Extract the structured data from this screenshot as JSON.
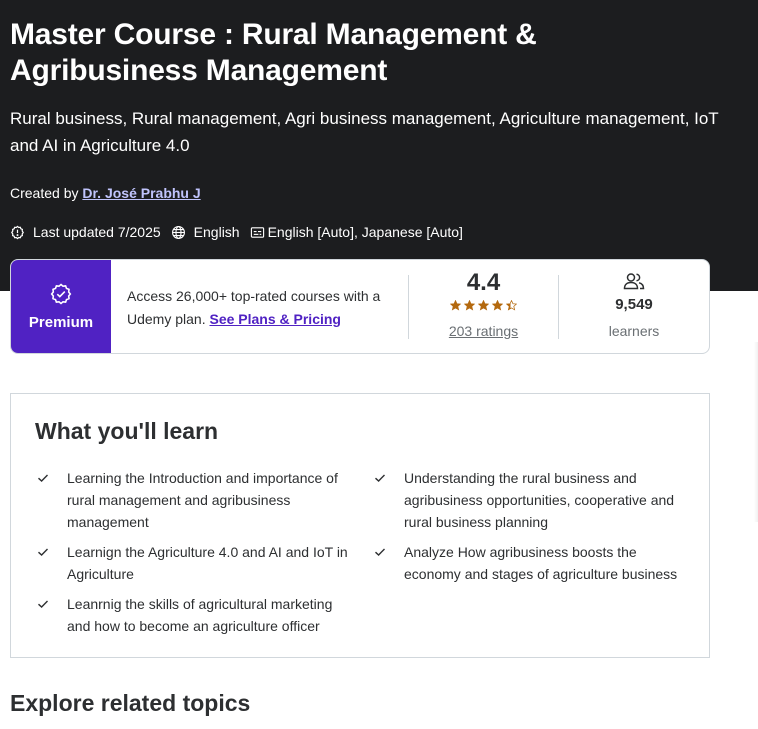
{
  "course": {
    "title": "Master Course : Rural Management & Agribusiness Management",
    "subtitle": "Rural business, Rural management, Agri business management, Agriculture management, IoT and AI in Agriculture 4.0",
    "created_by_prefix": "Created by",
    "author": "Dr. José Prabhu J",
    "last_updated": "Last updated 7/2025",
    "language": "English",
    "captions": "English [Auto], Japanese [Auto]"
  },
  "plan_card": {
    "badge": "Premium",
    "access_text": "Access 26,000+ top-rated courses with a Udemy plan.",
    "plans_link": "See Plans & Pricing",
    "rating": "4.4",
    "rating_value": 4.4,
    "ratings_count": "203 ratings",
    "learners_count": "9,549",
    "learners_label": "learners",
    "star_color": "#b4690e"
  },
  "learn": {
    "title": "What you'll learn",
    "items": [
      "Learning the Introduction and importance of rural management and agribusiness management",
      "Understanding the rural business and agribusiness opportunities, cooperative and rural business planning",
      "Learnign the Agriculture 4.0 and AI and IoT in Agriculture",
      "Analyze How agribusiness boosts the economy and stages of agriculture business",
      "Leanrnig the skills of agricultural marketing and how to become an agriculture officer"
    ]
  },
  "explore": {
    "title": "Explore related topics"
  },
  "colors": {
    "hero_bg": "#1c1d1f",
    "premium_bg": "#5022c3",
    "link_purple": "#5022c3",
    "author_link": "#c0c4fc"
  }
}
